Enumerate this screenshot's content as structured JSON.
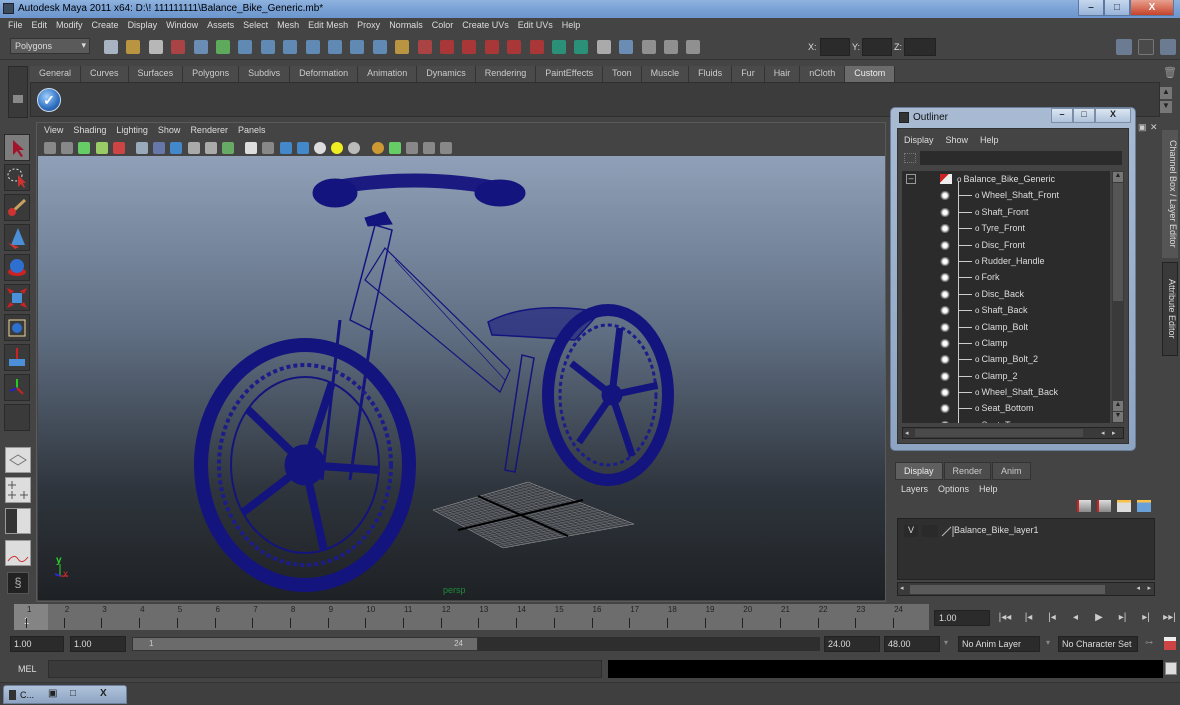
{
  "window": {
    "title": "Autodesk Maya 2011 x64: D:\\! 111111111\\Balance_Bike_Generic.mb*",
    "controls": {
      "minimize": "–",
      "maximize": "□",
      "close": "X"
    }
  },
  "menubar": [
    "File",
    "Edit",
    "Modify",
    "Create",
    "Display",
    "Window",
    "Assets",
    "Select",
    "Mesh",
    "Edit Mesh",
    "Proxy",
    "Normals",
    "Color",
    "Create UVs",
    "Edit UVs",
    "Help"
  ],
  "statusline": {
    "menuset": "Polygons",
    "xyz": {
      "x_label": "X:",
      "y_label": "Y:",
      "z_label": "Z:",
      "x_value": "",
      "y_value": "",
      "z_value": ""
    },
    "icons": [
      "new-scene-icon",
      "open-scene-icon",
      "save-scene-icon",
      "select-by-hierarchy-icon",
      "select-by-object-icon",
      "select-by-component-icon",
      "snap-grid-icon",
      "snap-curve-icon",
      "snap-point-icon",
      "snap-plane-icon",
      "snap-live-icon",
      "history-icon",
      "help-icon",
      "lock-icon",
      "highlight-icon",
      "magnet-1-icon",
      "magnet-2-icon",
      "magnet-3-icon",
      "magnet-4-icon",
      "magnet-5-icon",
      "render-current-icon",
      "ipr-render-icon",
      "render-settings-icon",
      "hypershade-icon",
      "render-view-icon",
      "batch-render-icon",
      "input-icon"
    ]
  },
  "shelf": {
    "tabs": [
      "General",
      "Curves",
      "Surfaces",
      "Polygons",
      "Subdivs",
      "Deformation",
      "Animation",
      "Dynamics",
      "Rendering",
      "PaintEffects",
      "Toon",
      "Muscle",
      "Fluids",
      "Fur",
      "Hair",
      "nCloth",
      "Custom"
    ],
    "active_tab": "Custom",
    "items": [
      "checkmark-icon"
    ]
  },
  "toolbox": [
    "select-tool",
    "lasso-tool",
    "paint-select-tool",
    "move-tool",
    "rotate-tool",
    "scale-tool",
    "universal-manipulator",
    "soft-mod-tool",
    "show-manipulator",
    "last-tool"
  ],
  "layouts": [
    "single-perspective-layout",
    "four-view-layout",
    "outliner-persp-layout",
    "persp-graph-layout",
    "maya-logo"
  ],
  "viewport": {
    "menu": [
      "View",
      "Shading",
      "Lighting",
      "Show",
      "Renderer",
      "Panels"
    ],
    "camera_label": "persp",
    "axis": {
      "y": "y",
      "x": "x",
      "z": "z"
    },
    "colors": {
      "wireframe": "#14147e",
      "axis_x": "#d42a2a",
      "axis_y": "#2ad42a",
      "axis_z": "#2a2ad4",
      "camera_label": "#1e8c3a"
    }
  },
  "outliner": {
    "title": "Outliner",
    "menu": [
      "Display",
      "Show",
      "Help"
    ],
    "root": "Balance_Bike_Generic",
    "items": [
      "Wheel_Shaft_Front",
      "Shaft_Front",
      "Tyre_Front",
      "Disc_Front",
      "Rudder_Handle",
      "Fork",
      "Disc_Back",
      "Shaft_Back",
      "Clamp_Bolt",
      "Clamp",
      "Clamp_Bolt_2",
      "Clamp_2",
      "Wheel_Shaft_Back",
      "Seat_Bottom",
      "Seat_Top"
    ]
  },
  "side_tabs": [
    "Channel Box / Layer Editor",
    "Attribute Editor"
  ],
  "layer_editor": {
    "tabs": [
      "Display",
      "Render",
      "Anim"
    ],
    "active_tab": "Display",
    "menu": [
      "Layers",
      "Options",
      "Help"
    ],
    "layers": [
      {
        "visible": "V",
        "name": "Balance_Bike_layer1"
      }
    ]
  },
  "timeline": {
    "ticks": [
      "1",
      "2",
      "3",
      "4",
      "5",
      "6",
      "7",
      "8",
      "9",
      "10",
      "11",
      "12",
      "13",
      "14",
      "15",
      "16",
      "17",
      "18",
      "19",
      "20",
      "21",
      "22",
      "23",
      "24"
    ],
    "current_frame_marker": "1",
    "current_time": "1.00",
    "playback_buttons": [
      "go-to-start",
      "step-back-key",
      "step-back-frame",
      "play-backward",
      "play-forward",
      "step-forward-frame",
      "step-forward-key",
      "go-to-end"
    ]
  },
  "range": {
    "start_time": "1.00",
    "playback_start": "1.00",
    "range_start_label": "1",
    "range_end_label": "24",
    "playback_end": "24.00",
    "end_time": "48.00",
    "anim_layer": "No Anim Layer",
    "character_set": "No Character Set"
  },
  "command_line": {
    "label": "MEL",
    "value": ""
  },
  "minimized_window": {
    "label": "C..."
  }
}
